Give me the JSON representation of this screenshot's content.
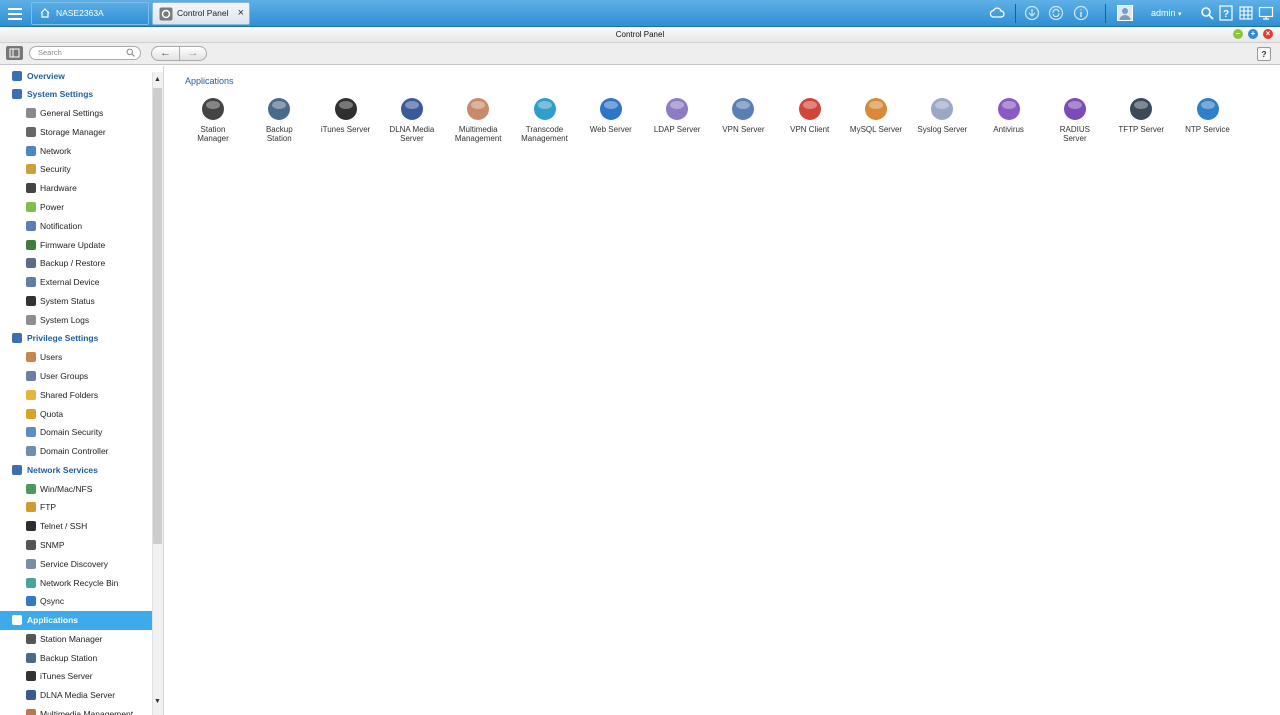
{
  "topbar": {
    "home_tab": "NASE2363A",
    "active_tab": "Control Panel",
    "user": "admin",
    "icons": [
      "cloud-icon",
      "download-icon",
      "sync-icon",
      "info-icon",
      "user-avatar-icon",
      "search-icon",
      "help-icon",
      "grid-icon",
      "monitor-icon"
    ]
  },
  "window": {
    "title": "Control Panel"
  },
  "toolbar": {
    "search_placeholder": "Search",
    "back": "←",
    "forward": "→",
    "help": "?"
  },
  "sidebar": {
    "items": [
      {
        "label": "Overview",
        "kind": "section",
        "color": "#3a6fb0"
      },
      {
        "label": "System Settings",
        "kind": "section",
        "color": "#3a6fb0"
      },
      {
        "label": "General Settings",
        "kind": "sub",
        "color": "#8a8a8a"
      },
      {
        "label": "Storage Manager",
        "kind": "sub",
        "color": "#666666"
      },
      {
        "label": "Network",
        "kind": "sub",
        "color": "#4a86c8"
      },
      {
        "label": "Security",
        "kind": "sub",
        "color": "#c9a23c"
      },
      {
        "label": "Hardware",
        "kind": "sub",
        "color": "#444444"
      },
      {
        "label": "Power",
        "kind": "sub",
        "color": "#7cbf4a"
      },
      {
        "label": "Notification",
        "kind": "sub",
        "color": "#5a7fb5"
      },
      {
        "label": "Firmware Update",
        "kind": "sub",
        "color": "#3f7d3f"
      },
      {
        "label": "Backup / Restore",
        "kind": "sub",
        "color": "#5a6c8a"
      },
      {
        "label": "External Device",
        "kind": "sub",
        "color": "#5f7fa7"
      },
      {
        "label": "System Status",
        "kind": "sub",
        "color": "#333333"
      },
      {
        "label": "System Logs",
        "kind": "sub",
        "color": "#8f8f8f"
      },
      {
        "label": "Privilege Settings",
        "kind": "section",
        "color": "#3a6fb0"
      },
      {
        "label": "Users",
        "kind": "sub",
        "color": "#c8864a"
      },
      {
        "label": "User Groups",
        "kind": "sub",
        "color": "#6a7fa5"
      },
      {
        "label": "Shared Folders",
        "kind": "sub",
        "color": "#e6b33c"
      },
      {
        "label": "Quota",
        "kind": "sub",
        "color": "#d9a32b"
      },
      {
        "label": "Domain Security",
        "kind": "sub",
        "color": "#5a8fc4"
      },
      {
        "label": "Domain Controller",
        "kind": "sub",
        "color": "#6b8fb2"
      },
      {
        "label": "Network Services",
        "kind": "section",
        "color": "#3a6fb0"
      },
      {
        "label": "Win/Mac/NFS",
        "kind": "sub",
        "color": "#4c9a5a"
      },
      {
        "label": "FTP",
        "kind": "sub",
        "color": "#d29a33"
      },
      {
        "label": "Telnet / SSH",
        "kind": "sub",
        "color": "#2d2d2d"
      },
      {
        "label": "SNMP",
        "kind": "sub",
        "color": "#555555"
      },
      {
        "label": "Service Discovery",
        "kind": "sub",
        "color": "#7a8fa5"
      },
      {
        "label": "Network Recycle Bin",
        "kind": "sub",
        "color": "#4aa3a0"
      },
      {
        "label": "Qsync",
        "kind": "sub",
        "color": "#2f7ac4"
      },
      {
        "label": "Applications",
        "kind": "section",
        "color": "#ffffff",
        "active": true
      },
      {
        "label": "Station Manager",
        "kind": "sub",
        "color": "#555555"
      },
      {
        "label": "Backup Station",
        "kind": "sub",
        "color": "#4a6a8a"
      },
      {
        "label": "iTunes Server",
        "kind": "sub",
        "color": "#333333"
      },
      {
        "label": "DLNA Media Server",
        "kind": "sub",
        "color": "#3a5a8a"
      },
      {
        "label": "Multimedia Management",
        "kind": "sub",
        "color": "#c2744a"
      }
    ]
  },
  "main": {
    "title": "Applications",
    "apps": [
      {
        "label": "Station\nManager",
        "icon": "station-manager-icon",
        "color": "#444444"
      },
      {
        "label": "Backup\nStation",
        "icon": "backup-station-icon",
        "color": "#4a6a8a"
      },
      {
        "label": "iTunes Server",
        "icon": "itunes-server-icon",
        "color": "#2f2f2f"
      },
      {
        "label": "DLNA Media\nServer",
        "icon": "dlna-media-server-icon",
        "color": "#3a5a9a"
      },
      {
        "label": "Multimedia\nManagement",
        "icon": "multimedia-management-icon",
        "color": "#c98a6a"
      },
      {
        "label": "Transcode\nManagement",
        "icon": "transcode-management-icon",
        "color": "#2f9fc8"
      },
      {
        "label": "Web Server",
        "icon": "web-server-icon",
        "color": "#2e74c9"
      },
      {
        "label": "LDAP Server",
        "icon": "ldap-server-icon",
        "color": "#8e7bc4"
      },
      {
        "label": "VPN Server",
        "icon": "vpn-server-icon",
        "color": "#5a7fb5"
      },
      {
        "label": "VPN Client",
        "icon": "vpn-client-icon",
        "color": "#d1463a"
      },
      {
        "label": "MySQL Server",
        "icon": "mysql-server-icon",
        "color": "#d78a3a"
      },
      {
        "label": "Syslog Server",
        "icon": "syslog-server-icon",
        "color": "#9aa7c7"
      },
      {
        "label": "Antivirus",
        "icon": "antivirus-icon",
        "color": "#8a5ac4"
      },
      {
        "label": "RADIUS\nServer",
        "icon": "radius-server-icon",
        "color": "#7b4bb8"
      },
      {
        "label": "TFTP Server",
        "icon": "tftp-server-icon",
        "color": "#3a4a5a"
      },
      {
        "label": "NTP Service",
        "icon": "ntp-service-icon",
        "color": "#2f7fc8"
      }
    ]
  }
}
